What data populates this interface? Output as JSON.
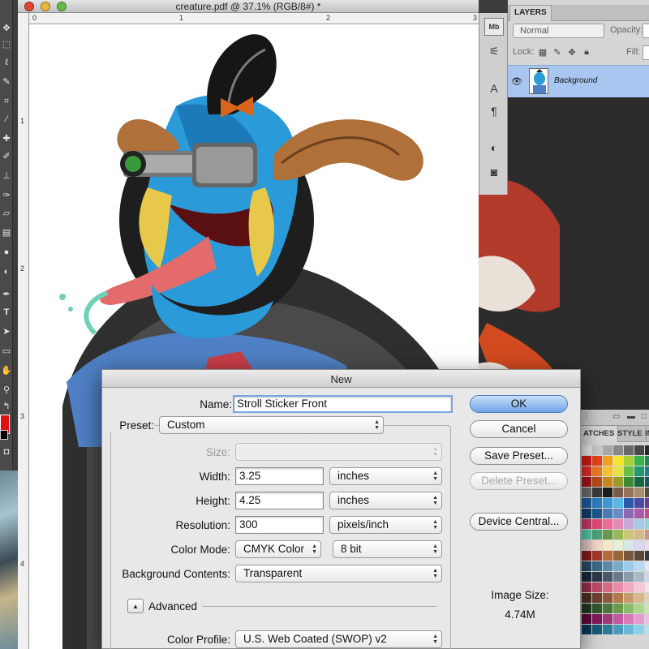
{
  "document": {
    "title": "creature.pdf @ 37.1% (RGB/8#) *",
    "ruler_top_numbers": [
      "0",
      "1",
      "2",
      "3"
    ],
    "ruler_left_numbers": [
      "1",
      "2",
      "3",
      "4"
    ]
  },
  "toolbar": {
    "tools": [
      "move-tool",
      "marquee-tool",
      "lasso-tool",
      "quick-select-tool",
      "crop-tool",
      "eyedropper-tool",
      "healing-brush-tool",
      "brush-tool",
      "clone-stamp-tool",
      "history-brush-tool",
      "eraser-tool",
      "gradient-tool",
      "blur-tool",
      "dodge-tool",
      "pen-tool",
      "type-tool",
      "path-select-tool",
      "shape-tool",
      "3d-rotate-tool",
      "hand-tool",
      "zoom-tool"
    ],
    "foreground_color": "#e01010",
    "background_color": "#000000"
  },
  "icon_dock": {
    "icons": [
      "mini-bridge-icon",
      "brush-presets-icon",
      "character-icon",
      "paragraph-icon",
      "adjustments-icon",
      "masks-icon"
    ]
  },
  "layers": {
    "tab_label": "LAYERS",
    "blend_mode": "Normal",
    "opacity_label": "Opacity:",
    "lock_label": "Lock:",
    "fill_label": "Fill:",
    "layer_name": "Background"
  },
  "swatches": {
    "tabs": [
      "ATCHES",
      "STYLE",
      "IN"
    ],
    "colors": [
      "#e8e8e8",
      "#c8c8c8",
      "#a8a8a8",
      "#888888",
      "#686868",
      "#484848",
      "#282828",
      "#d41a1a",
      "#e7431a",
      "#f1a11e",
      "#f6e52b",
      "#a8cf3a",
      "#3ab34a",
      "#1e8b4a",
      "#e12a2a",
      "#ee7b22",
      "#f7c22b",
      "#e5e145",
      "#6bbd45",
      "#1e9a6e",
      "#1b7f8c",
      "#a3151f",
      "#b84a1c",
      "#c98a1b",
      "#9b9a2c",
      "#3d8a35",
      "#146a3d",
      "#0d5b5b",
      "#6c6c6c",
      "#3a3a3a",
      "#1c1c1c",
      "#7a5a4a",
      "#94735a",
      "#a88d6b",
      "#5c4a3a",
      "#1c5f9c",
      "#2c7ec2",
      "#3d9ad8",
      "#5ab8e6",
      "#2a5ba8",
      "#4a4aa8",
      "#6a3a9c",
      "#123f6c",
      "#1a5a8c",
      "#4a7ab8",
      "#6a8ac8",
      "#8a6ab8",
      "#aa5aa8",
      "#c84a8c",
      "#c83a6c",
      "#e84a7a",
      "#f06a9a",
      "#e88ab8",
      "#c8a8d8",
      "#a8c8e8",
      "#88d8d8",
      "#58c8a8",
      "#48a878",
      "#689848",
      "#98b858",
      "#c8c878",
      "#d8b888",
      "#c89878",
      "#e8c8c8",
      "#f8d8c8",
      "#f8e8c8",
      "#e8f0d8",
      "#d8e8e8",
      "#d8d8f0",
      "#f0d8e8",
      "#8c1a1a",
      "#a83a2a",
      "#b86a3a",
      "#98683a",
      "#785a3a",
      "#5a4a3a",
      "#3a3a3a",
      "#2a4a6a",
      "#3a6a8a",
      "#5a8aaa",
      "#7aaaca",
      "#9acae8",
      "#bad8f0",
      "#dae8f8",
      "#1a2a3a",
      "#2a3a4a",
      "#4a5a6a",
      "#6a7a8a",
      "#8a9aaa",
      "#aabaca",
      "#cad8e8",
      "#a03050",
      "#c04a6a",
      "#d86a88",
      "#e88aa8",
      "#f0aac0",
      "#f8c8d8",
      "#fce0ea",
      "#503020",
      "#704030",
      "#905a3a",
      "#b07a4a",
      "#c89a6a",
      "#d8b88a",
      "#e8d0aa",
      "#203a20",
      "#305a30",
      "#4a7a3a",
      "#6a9a4a",
      "#8aba6a",
      "#aad88a",
      "#c8e8aa",
      "#600a3a",
      "#801a5a",
      "#a03a7a",
      "#c05a9a",
      "#d87ab8",
      "#e89ad0",
      "#f4bae4",
      "#0a3a5a",
      "#1a5a7a",
      "#2a7a9a",
      "#4a9aba",
      "#6ab8d8",
      "#8ad0e8",
      "#aae4f4"
    ]
  },
  "dialog": {
    "title": "New",
    "name_label": "Name:",
    "name_value": "Stroll Sticker Front",
    "preset_label": "Preset:",
    "preset_value": "Custom",
    "size_label": "Size:",
    "width_label": "Width:",
    "width_value": "3.25",
    "width_unit": "inches",
    "height_label": "Height:",
    "height_value": "4.25",
    "height_unit": "inches",
    "resolution_label": "Resolution:",
    "resolution_value": "300",
    "resolution_unit": "pixels/inch",
    "color_mode_label": "Color Mode:",
    "color_mode_value": "CMYK Color",
    "bit_depth_value": "8 bit",
    "bg_contents_label": "Background Contents:",
    "bg_contents_value": "Transparent",
    "advanced_label": "Advanced",
    "color_profile_label": "Color Profile:",
    "color_profile_value": "U.S. Web Coated (SWOP) v2",
    "buttons": {
      "ok": "OK",
      "cancel": "Cancel",
      "save_preset": "Save Preset...",
      "delete_preset": "Delete Preset...",
      "device_central": "Device Central..."
    },
    "image_size_label": "Image Size:",
    "image_size_value": "4.74M"
  }
}
